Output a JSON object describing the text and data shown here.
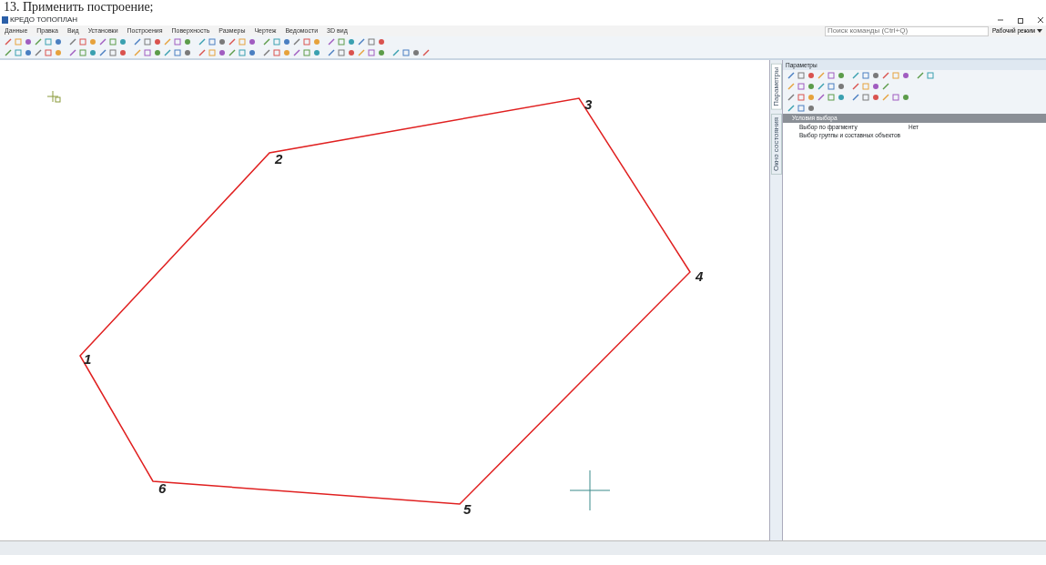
{
  "caption": "13. Применить построение;",
  "window": {
    "title": "КРЕДО ТОПОПЛАН"
  },
  "menu": [
    "Данные",
    "Правка",
    "Вид",
    "Установки",
    "Построения",
    "Поверхность",
    "Размеры",
    "Чертеж",
    "Ведомости",
    "3D вид"
  ],
  "search": {
    "placeholder": "Поиск команды (Ctrl+Q)"
  },
  "mode": {
    "label": "Рабочий режим"
  },
  "canvas": {
    "vertices": [
      "1",
      "2",
      "3",
      "4",
      "5",
      "6"
    ]
  },
  "side_tabs": [
    {
      "label": "Параметры",
      "selected": true
    },
    {
      "label": "Окно состояния",
      "selected": false
    }
  ],
  "panel": {
    "title": "Параметры",
    "section": "Условия выбора",
    "rows": [
      {
        "label": "Выбор по фрагменту",
        "value": "Нет"
      },
      {
        "label": "Выбор группы и составных объектов",
        "value": ""
      }
    ]
  }
}
